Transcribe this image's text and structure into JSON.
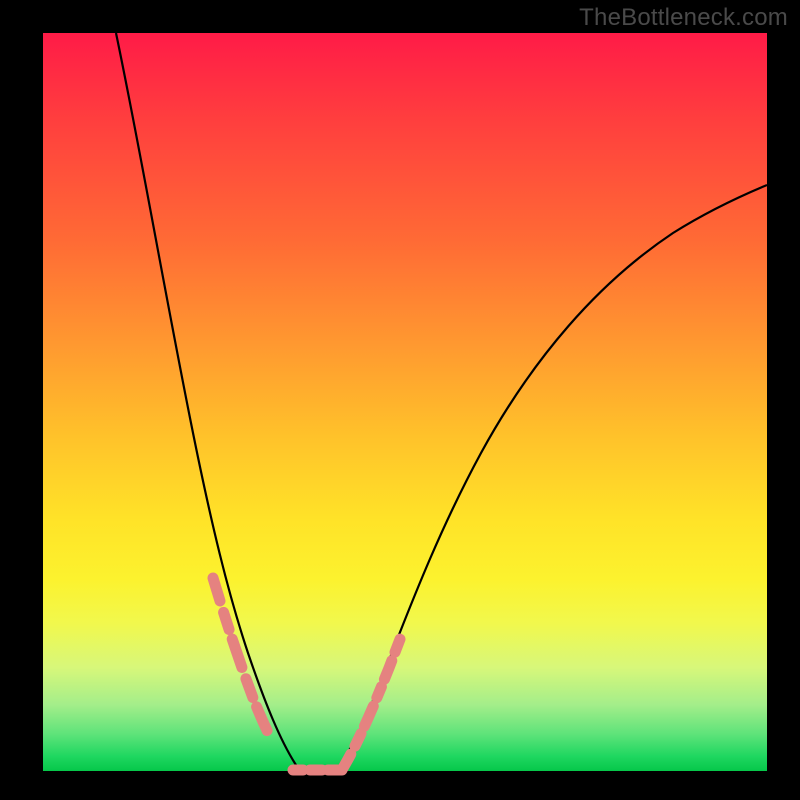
{
  "watermark": "TheBottleneck.com",
  "colors": {
    "frame": "#000000",
    "curve_stroke": "#000000",
    "dash_stroke": "#e58280",
    "gradient_stops": [
      "#ff1b47",
      "#ff6a35",
      "#ffc32a",
      "#fcf22e",
      "#a4ee8a",
      "#06c74a"
    ]
  },
  "chart_data": {
    "type": "line",
    "title": "",
    "xlabel": "",
    "ylabel": "",
    "xlim": [
      0,
      100
    ],
    "ylim": [
      0,
      100
    ],
    "series": [
      {
        "name": "bottleneck-curve",
        "x": [
          10,
          12,
          14,
          16,
          18,
          20,
          22,
          24,
          26,
          28,
          30,
          31,
          32,
          33,
          34,
          35,
          36,
          38,
          40,
          42,
          44,
          48,
          52,
          56,
          60,
          66,
          72,
          80,
          90,
          100
        ],
        "y": [
          100,
          90,
          80,
          70,
          61,
          52,
          44,
          36,
          28,
          20,
          12,
          8,
          5,
          2,
          0,
          0,
          0,
          2,
          5,
          9,
          14,
          24,
          33,
          41,
          48,
          56,
          62,
          68,
          73,
          76
        ]
      }
    ],
    "annotations": {
      "highlight_dashes": [
        {
          "x_range": [
            22.5,
            28.5
          ],
          "note": "left descending flank dashed overlay"
        },
        {
          "x_range": [
            31.0,
            37.0
          ],
          "note": "trough dashed overlay"
        },
        {
          "x_range": [
            37.5,
            45.0
          ],
          "note": "right ascending flank dashed overlay"
        }
      ]
    }
  }
}
